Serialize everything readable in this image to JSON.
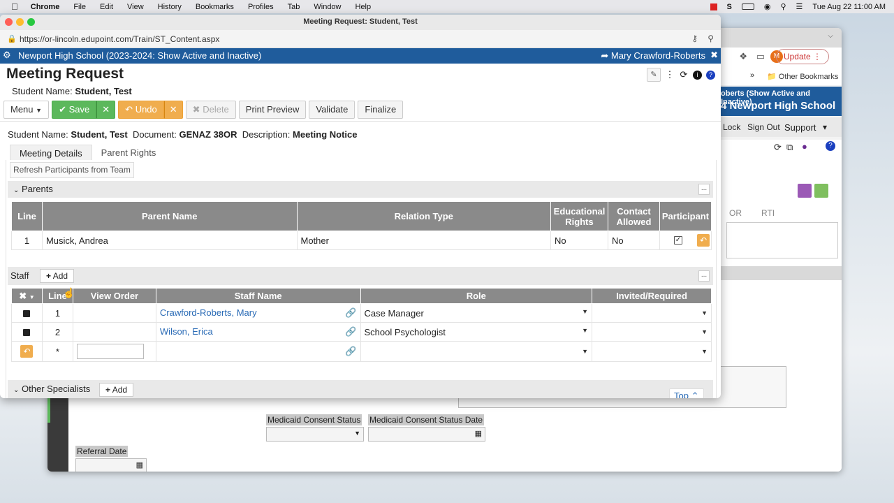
{
  "menubar": {
    "app": "Chrome",
    "items": [
      "File",
      "Edit",
      "View",
      "History",
      "Bookmarks",
      "Profiles",
      "Tab",
      "Window",
      "Help"
    ],
    "clock": "Tue Aug 22  11:00 AM"
  },
  "background_window": {
    "update_label": "Update",
    "avatar_letter": "M",
    "bookmarks_label": "Other Bookmarks",
    "banner_line1": "oberts (Show Active and Inactive)",
    "banner_line2": "4 Newport High School",
    "nav": {
      "lock": "Lock",
      "sign_out": "Sign Out",
      "support": "Support"
    },
    "tabs": [
      "OR",
      "RTI"
    ],
    "labels": {
      "medicaid_status": "Medicaid Consent Status",
      "medicaid_date": "Medicaid Consent Status Date",
      "referral_date": "Referral Date"
    }
  },
  "window": {
    "title": "Meeting Request: Student, Test",
    "url": "https://or-lincoln.edupoint.com/Train/ST_Content.aspx"
  },
  "schoolbar": {
    "school": "Newport High School  (2023-2024: Show Active and Inactive)",
    "user": "Mary Crawford-Roberts"
  },
  "page": {
    "title": "Meeting Request",
    "student_label": "Student Name:",
    "student_value": "Student, Test"
  },
  "toolbar": {
    "menu": "Menu",
    "save": "Save",
    "undo": "Undo",
    "delete": "Delete",
    "print_preview": "Print Preview",
    "validate": "Validate",
    "finalize": "Finalize"
  },
  "docline": {
    "student_label": "Student Name:",
    "student_value": "Student, Test",
    "document_label": "Document:",
    "document_value": "GENAZ 38OR",
    "description_label": "Description:",
    "description_value": "Meeting Notice"
  },
  "tabs": [
    "Meeting Details",
    "Parent Rights"
  ],
  "refresh_button": "Refresh Participants from Team",
  "parents": {
    "title": "Parents",
    "more": "...",
    "columns": [
      "Line",
      "Parent Name",
      "Relation Type",
      "Educational Rights",
      "Contact Allowed",
      "Participant"
    ],
    "rows": [
      {
        "line": "1",
        "name": "Musick, Andrea",
        "relation": "Mother",
        "edu_rights": "No",
        "contact": "No"
      }
    ]
  },
  "staff": {
    "title": "Staff",
    "add": "Add",
    "more": "...",
    "columns": [
      "Line",
      "View Order",
      "Staff Name",
      "Role",
      "Invited/Required"
    ],
    "rows": [
      {
        "line": "1",
        "name": "Crawford-Roberts, Mary",
        "role": "Case Manager"
      },
      {
        "line": "2",
        "name": "Wilson, Erica",
        "role": "School Psychologist"
      }
    ],
    "new_row_marker": "*"
  },
  "other_specialists": {
    "title": "Other Specialists",
    "add": "Add"
  },
  "top_button": "Top"
}
